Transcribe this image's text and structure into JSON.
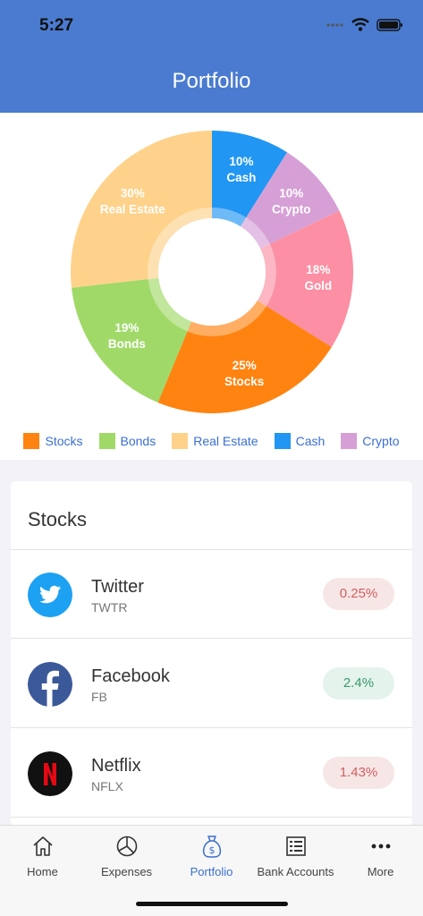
{
  "status_bar": {
    "time": "5:27"
  },
  "header": {
    "title": "Portfolio"
  },
  "chart_data": {
    "type": "pie",
    "slices": [
      {
        "name": "Cash",
        "value": 10,
        "label_pct": "10%",
        "label_name": "Cash",
        "color": "#2196f3"
      },
      {
        "name": "Crypto",
        "value": 10,
        "label_pct": "10%",
        "label_name": "Crypto",
        "color": "#d6a0d6"
      },
      {
        "name": "Gold",
        "value": 18,
        "label_pct": "18%",
        "label_name": "Gold",
        "color": "#fc8fa3"
      },
      {
        "name": "Stocks",
        "value": 25,
        "label_pct": "25%",
        "label_name": "Stocks",
        "color": "#ff8310"
      },
      {
        "name": "Bonds",
        "value": 19,
        "label_pct": "19%",
        "label_name": "Bonds",
        "color": "#a0d968"
      },
      {
        "name": "Real Estate",
        "value": 30,
        "label_pct": "30%",
        "label_name": "Real Estate",
        "color": "#fed28b"
      }
    ],
    "legend": [
      {
        "label": "Stocks",
        "color": "#ff8310"
      },
      {
        "label": "Bonds",
        "color": "#a0d968"
      },
      {
        "label": "Real Estate",
        "color": "#fed28b"
      },
      {
        "label": "Cash",
        "color": "#2196f3"
      },
      {
        "label": "Crypto",
        "color": "#d6a0d6"
      }
    ]
  },
  "stocks_card": {
    "title": "Stocks",
    "items": [
      {
        "name": "Twitter",
        "ticker": "TWTR",
        "change": "0.25%",
        "trend": "down",
        "icon": "twitter-logo"
      },
      {
        "name": "Facebook",
        "ticker": "FB",
        "change": "2.4%",
        "trend": "up",
        "icon": "facebook-logo"
      },
      {
        "name": "Netflix",
        "ticker": "NFLX",
        "change": "1.43%",
        "trend": "down",
        "icon": "netflix-logo"
      }
    ]
  },
  "tabbar": {
    "tabs": [
      {
        "label": "Home",
        "icon": "home-icon"
      },
      {
        "label": "Expenses",
        "icon": "pie-chart-icon"
      },
      {
        "label": "Portfolio",
        "icon": "money-bag-icon"
      },
      {
        "label": "Bank Accounts",
        "icon": "list-icon"
      },
      {
        "label": "More",
        "icon": "more-icon"
      }
    ],
    "active": "Portfolio"
  },
  "colors": {
    "accent": "#4a7bd0",
    "active_tab": "#3a6fd0"
  }
}
